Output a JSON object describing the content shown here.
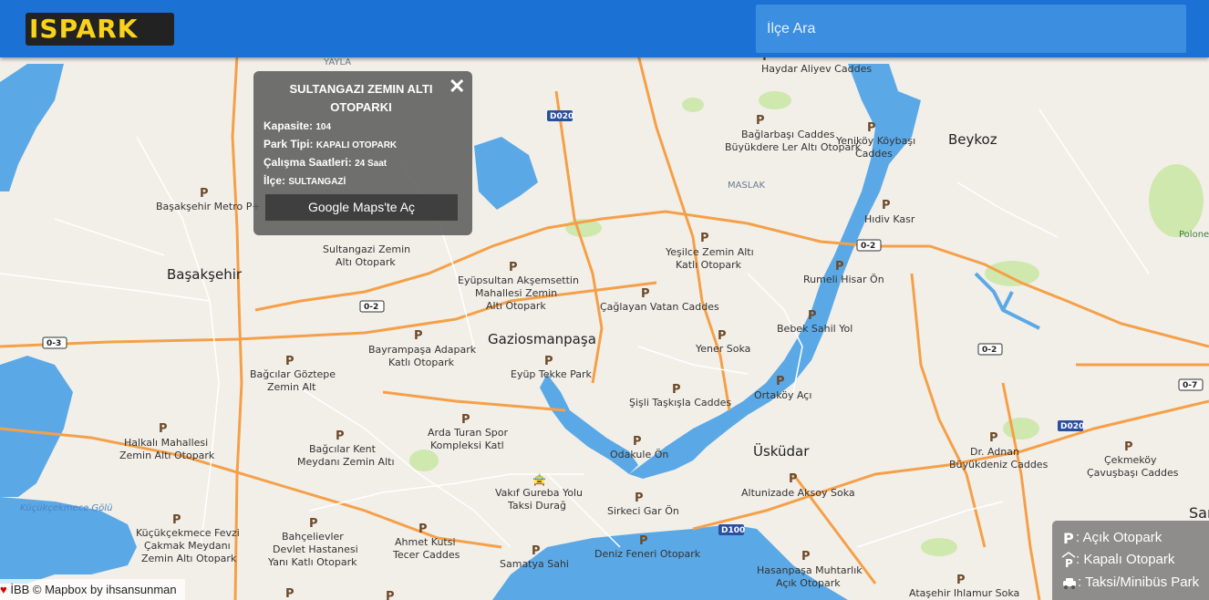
{
  "header": {
    "logo_text": "ISPARK",
    "search_placeholder": "İlçe Ara"
  },
  "popup": {
    "title": "SULTANGAZI ZEMIN ALTI OTOPARKI",
    "close_symbol": "✕",
    "rows": [
      {
        "label": "Kapasite:",
        "value": "104"
      },
      {
        "label": "Park Tipi:",
        "value": "KAPALI OTOPARK"
      },
      {
        "label": "Çalışma Saatleri:",
        "value": "24 Saat"
      },
      {
        "label": "İlçe:",
        "value": "SULTANGAZİ"
      }
    ],
    "button_label": "Google Maps'te Aç"
  },
  "legend": {
    "items": [
      {
        "label": ": Açık Otopark",
        "icon": "open-parking-icon"
      },
      {
        "label": ": Kapalı Otopark",
        "icon": "covered-parking-icon"
      },
      {
        "label": ": Taksi/Minibüs Park",
        "icon": "taxi-icon"
      }
    ]
  },
  "attribution": {
    "heart": "♥",
    "text": "İBB © Mapbox by ihsansunman"
  },
  "map": {
    "districts": [
      "Başakşehir",
      "Gaziosmanpaşa",
      "Üsküdar",
      "Beykoz"
    ],
    "parking_labels": [
      "Haydar Aliyev Caddes",
      "Bağlarbaşı Caddes",
      "Büyükdere Ler Altı Otopark",
      "Yeniköy Köybaşı Caddes",
      "Hıdiv Kasr",
      "Başakşehir Metro P+",
      "Sultangazi Zemin Altı Otopark",
      "Yeşilce Zemin Altı Katlı Otopark",
      "Rumeli Hisar Ön",
      "Eyüpsultan Akşemsettin Mahallesi Zemin Altı Otopark",
      "Çağlayan Vatan Caddes",
      "Bebek Sahil Yol",
      "Bayrampaşa Adapark Katlı Otopark",
      "Yener Soka",
      "Bağcılar Göztepe Zemin Alt",
      "Eyüp Tekke Park",
      "Ortaköy Açı",
      "Şişli Taşkışla Caddes",
      "Halkalı Mahallesi Zemin Altı Otopark",
      "Arda Turan Spor Kompleksi Katl",
      "Bağcılar Kent Meydanı Zemin Altı",
      "Odakule Ön",
      "Dr. Adnan Büyükdeniz Caddes",
      "Çekmeköy Çavuşbaşı Caddes",
      "Vakıf Gureba Yolu Taksi Durağ",
      "Altunizade Aksoy Soka",
      "Küçükçekmece Fevzi Çakmak Meydanı Zemin Altı Otopark",
      "Sirkeci Gar Ön",
      "Bahçelievler Devlet Hastanesi Yanı Katlı Otopark",
      "Ahmet Kutsi Tecer Caddes",
      "Deniz Feneri Otopark",
      "Samatya Sahi",
      "Hasanpaşa Muhtarlık Açık Otopark",
      "Ataşehir Ihlamur Soka"
    ],
    "place_labels": [
      "YAYLA",
      "MASLAK",
      "Küçükçekmece Gölü",
      "Polone",
      "Sar"
    ],
    "road_shields": [
      "D020",
      "0-2",
      "0-2",
      "0-3",
      "0-2",
      "0-7",
      "D020",
      "D100"
    ],
    "colors": {
      "land": "#f2efe9",
      "water": "#5aa9e6",
      "park": "#c8e6a0",
      "major_road": "#f5a048",
      "minor_road": "#ffffff",
      "header": "#1b71d4",
      "logo_yellow": "#f8d21b"
    }
  }
}
